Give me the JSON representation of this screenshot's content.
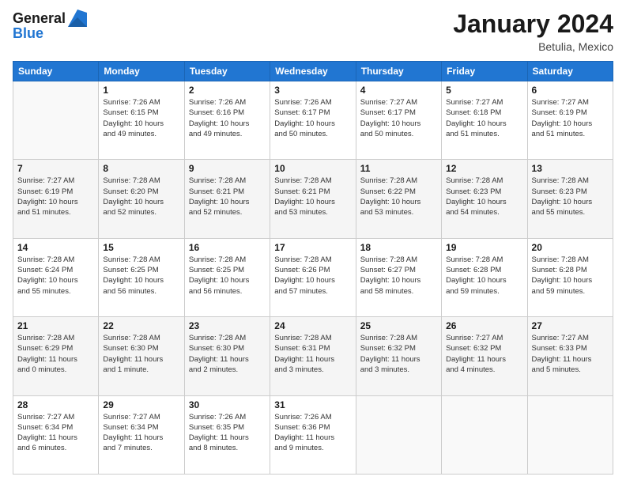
{
  "logo": {
    "line1": "General",
    "line2": "Blue"
  },
  "title": "January 2024",
  "subtitle": "Betulia, Mexico",
  "days_of_week": [
    "Sunday",
    "Monday",
    "Tuesday",
    "Wednesday",
    "Thursday",
    "Friday",
    "Saturday"
  ],
  "weeks": [
    [
      {
        "day": "",
        "info": ""
      },
      {
        "day": "1",
        "info": "Sunrise: 7:26 AM\nSunset: 6:15 PM\nDaylight: 10 hours\nand 49 minutes."
      },
      {
        "day": "2",
        "info": "Sunrise: 7:26 AM\nSunset: 6:16 PM\nDaylight: 10 hours\nand 49 minutes."
      },
      {
        "day": "3",
        "info": "Sunrise: 7:26 AM\nSunset: 6:17 PM\nDaylight: 10 hours\nand 50 minutes."
      },
      {
        "day": "4",
        "info": "Sunrise: 7:27 AM\nSunset: 6:17 PM\nDaylight: 10 hours\nand 50 minutes."
      },
      {
        "day": "5",
        "info": "Sunrise: 7:27 AM\nSunset: 6:18 PM\nDaylight: 10 hours\nand 51 minutes."
      },
      {
        "day": "6",
        "info": "Sunrise: 7:27 AM\nSunset: 6:19 PM\nDaylight: 10 hours\nand 51 minutes."
      }
    ],
    [
      {
        "day": "7",
        "info": "Sunrise: 7:27 AM\nSunset: 6:19 PM\nDaylight: 10 hours\nand 51 minutes."
      },
      {
        "day": "8",
        "info": "Sunrise: 7:28 AM\nSunset: 6:20 PM\nDaylight: 10 hours\nand 52 minutes."
      },
      {
        "day": "9",
        "info": "Sunrise: 7:28 AM\nSunset: 6:21 PM\nDaylight: 10 hours\nand 52 minutes."
      },
      {
        "day": "10",
        "info": "Sunrise: 7:28 AM\nSunset: 6:21 PM\nDaylight: 10 hours\nand 53 minutes."
      },
      {
        "day": "11",
        "info": "Sunrise: 7:28 AM\nSunset: 6:22 PM\nDaylight: 10 hours\nand 53 minutes."
      },
      {
        "day": "12",
        "info": "Sunrise: 7:28 AM\nSunset: 6:23 PM\nDaylight: 10 hours\nand 54 minutes."
      },
      {
        "day": "13",
        "info": "Sunrise: 7:28 AM\nSunset: 6:23 PM\nDaylight: 10 hours\nand 55 minutes."
      }
    ],
    [
      {
        "day": "14",
        "info": "Sunrise: 7:28 AM\nSunset: 6:24 PM\nDaylight: 10 hours\nand 55 minutes."
      },
      {
        "day": "15",
        "info": "Sunrise: 7:28 AM\nSunset: 6:25 PM\nDaylight: 10 hours\nand 56 minutes."
      },
      {
        "day": "16",
        "info": "Sunrise: 7:28 AM\nSunset: 6:25 PM\nDaylight: 10 hours\nand 56 minutes."
      },
      {
        "day": "17",
        "info": "Sunrise: 7:28 AM\nSunset: 6:26 PM\nDaylight: 10 hours\nand 57 minutes."
      },
      {
        "day": "18",
        "info": "Sunrise: 7:28 AM\nSunset: 6:27 PM\nDaylight: 10 hours\nand 58 minutes."
      },
      {
        "day": "19",
        "info": "Sunrise: 7:28 AM\nSunset: 6:28 PM\nDaylight: 10 hours\nand 59 minutes."
      },
      {
        "day": "20",
        "info": "Sunrise: 7:28 AM\nSunset: 6:28 PM\nDaylight: 10 hours\nand 59 minutes."
      }
    ],
    [
      {
        "day": "21",
        "info": "Sunrise: 7:28 AM\nSunset: 6:29 PM\nDaylight: 11 hours\nand 0 minutes."
      },
      {
        "day": "22",
        "info": "Sunrise: 7:28 AM\nSunset: 6:30 PM\nDaylight: 11 hours\nand 1 minute."
      },
      {
        "day": "23",
        "info": "Sunrise: 7:28 AM\nSunset: 6:30 PM\nDaylight: 11 hours\nand 2 minutes."
      },
      {
        "day": "24",
        "info": "Sunrise: 7:28 AM\nSunset: 6:31 PM\nDaylight: 11 hours\nand 3 minutes."
      },
      {
        "day": "25",
        "info": "Sunrise: 7:28 AM\nSunset: 6:32 PM\nDaylight: 11 hours\nand 3 minutes."
      },
      {
        "day": "26",
        "info": "Sunrise: 7:27 AM\nSunset: 6:32 PM\nDaylight: 11 hours\nand 4 minutes."
      },
      {
        "day": "27",
        "info": "Sunrise: 7:27 AM\nSunset: 6:33 PM\nDaylight: 11 hours\nand 5 minutes."
      }
    ],
    [
      {
        "day": "28",
        "info": "Sunrise: 7:27 AM\nSunset: 6:34 PM\nDaylight: 11 hours\nand 6 minutes."
      },
      {
        "day": "29",
        "info": "Sunrise: 7:27 AM\nSunset: 6:34 PM\nDaylight: 11 hours\nand 7 minutes."
      },
      {
        "day": "30",
        "info": "Sunrise: 7:26 AM\nSunset: 6:35 PM\nDaylight: 11 hours\nand 8 minutes."
      },
      {
        "day": "31",
        "info": "Sunrise: 7:26 AM\nSunset: 6:36 PM\nDaylight: 11 hours\nand 9 minutes."
      },
      {
        "day": "",
        "info": ""
      },
      {
        "day": "",
        "info": ""
      },
      {
        "day": "",
        "info": ""
      }
    ]
  ]
}
